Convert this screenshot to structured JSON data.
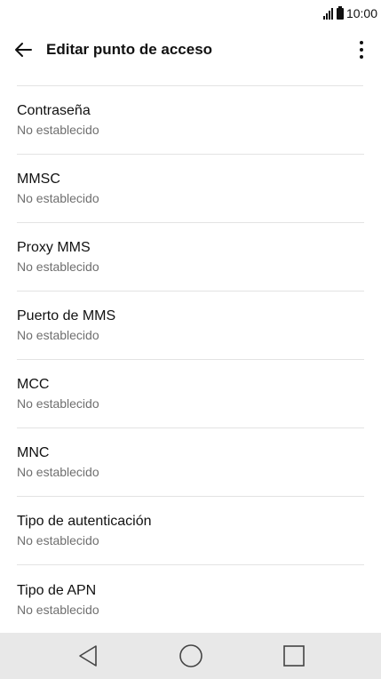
{
  "status_bar": {
    "time": "10:00"
  },
  "app_bar": {
    "title": "Editar punto de acceso"
  },
  "settings_items": [
    {
      "label": "Contraseña",
      "value": "No establecido"
    },
    {
      "label": "MMSC",
      "value": "No establecido"
    },
    {
      "label": "Proxy MMS",
      "value": "No establecido"
    },
    {
      "label": "Puerto de MMS",
      "value": "No establecido"
    },
    {
      "label": "MCC",
      "value": "No establecido"
    },
    {
      "label": "MNC",
      "value": "No establecido"
    },
    {
      "label": "Tipo de autenticación",
      "value": "No establecido"
    },
    {
      "label": "Tipo de APN",
      "value": "No establecido"
    }
  ],
  "icons": {
    "back": "arrow-back-icon",
    "menu": "more-vert-icon",
    "nav_back": "triangle-back-icon",
    "nav_home": "circle-home-icon",
    "nav_recents": "square-recents-icon"
  }
}
